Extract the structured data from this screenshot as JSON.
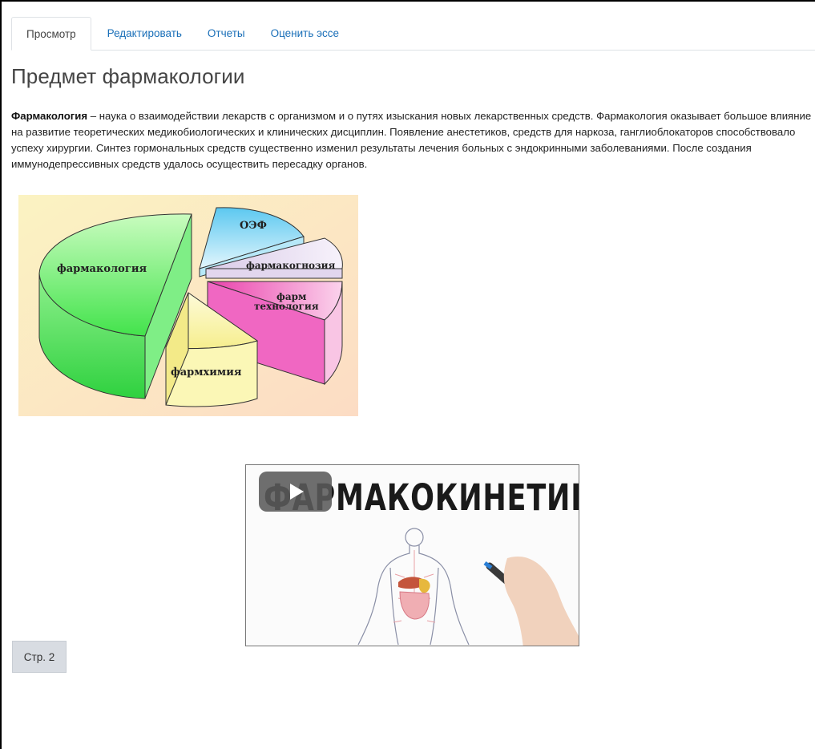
{
  "tabs": [
    {
      "label": "Просмотр",
      "active": true
    },
    {
      "label": "Редактировать",
      "active": false
    },
    {
      "label": "Отчеты",
      "active": false
    },
    {
      "label": "Оценить эссе",
      "active": false
    }
  ],
  "page_title": "Предмет фармакологии",
  "intro": {
    "term": "Фармакология",
    "text": " – наука о взаимодействии лекарств с организмом и о путях изыскания новых лекарственных средств. Фармакология оказывает большое влияние на развитие теоретических медикобиологических и клинических дисциплин. Появление анестетиков, средств для наркоза, ганглиоблокаторов способствовало успеху хирургии. Синтез гормональных средств существенно изменил результаты лечения больных с эндокринными заболеваниями. После создания иммунодепрессивных средств удалось осуществить пересадку органов."
  },
  "pie_image": {
    "labels": {
      "pharmacology": "фармакология",
      "oef": "ОЭФ",
      "pharmacognosy": "фармакогнозия",
      "pharm_tech_1": "фарм",
      "pharm_tech_2": "технология",
      "pharmchem": "фармхимия"
    },
    "colors": {
      "background": "#fde8cf",
      "pharmacology": "#7cf07a",
      "oef": "#7fd6f5",
      "pharmacognosy": "#e6dcf0",
      "pharm_tech": "#f26fc4",
      "pharmchem": "#fbf6b0"
    }
  },
  "video": {
    "title": "ФАРМАКОКИНЕТИКА",
    "play_icon": "play-icon"
  },
  "pagination": {
    "page_label": "Стр. 2"
  }
}
